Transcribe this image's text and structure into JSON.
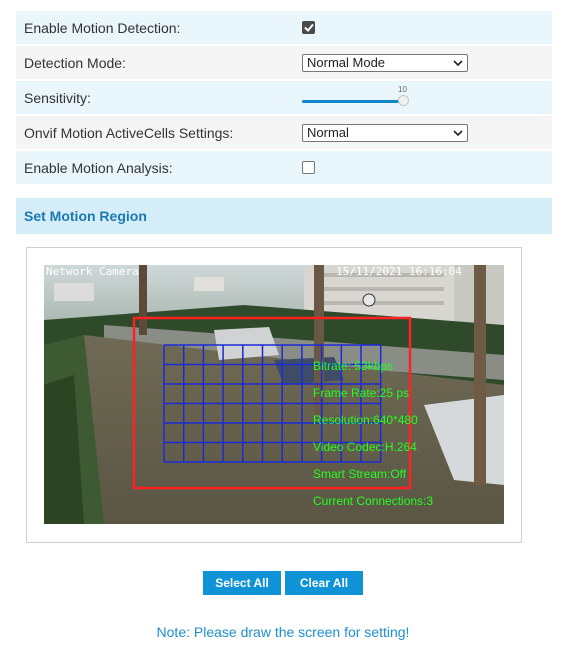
{
  "settings": [
    {
      "label": "Enable Motion Detection:",
      "type": "checkbox",
      "checked": true
    },
    {
      "label": "Detection Mode:",
      "type": "select",
      "value": "Normal Mode"
    },
    {
      "label": "Sensitivity:",
      "type": "slider",
      "value": "10",
      "level": 1.0
    },
    {
      "label": "Onvif Motion ActiveCells Settings:",
      "type": "select",
      "value": "Normal"
    },
    {
      "label": "Enable Motion Analysis:",
      "type": "checkbox",
      "checked": false
    }
  ],
  "section": {
    "title": "Set Motion Region"
  },
  "video": {
    "camera_name": "Network Camera",
    "timestamp": "15/11/2021 16:16:04",
    "overlay_lines": [
      "Bitrate: 53kbps",
      "Frame Rate:25 ps",
      "Resolution:640*480",
      "Video Codec:H.264",
      "Smart Stream:Off",
      "Current Connections:3"
    ],
    "overlay_color": "#22ff22",
    "region_color": "#ff2222",
    "grid_color": "#1a2bd6"
  },
  "buttons": {
    "select_all": "Select All",
    "clear_all": "Clear All"
  },
  "note": "Note: Please draw the screen for setting!"
}
